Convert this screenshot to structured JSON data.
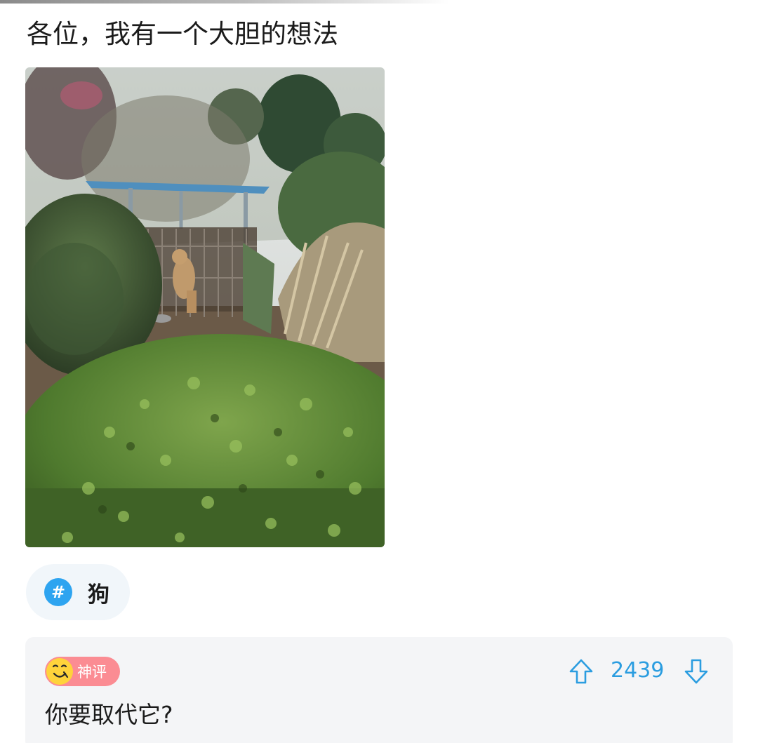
{
  "post": {
    "title": "各位，我有一个大胆的想法"
  },
  "topic": {
    "icon": "hashtag-icon",
    "icon_glyph": "#",
    "label": "狗"
  },
  "comment": {
    "badge_label": "神评",
    "badge_icon": "smiley-face-icon",
    "vote_count": "2439",
    "text": "你要取代它?"
  },
  "colors": {
    "accent_blue": "#2b9de0",
    "badge_pink": "#fb8c93",
    "badge_yellow": "#ffd33b",
    "card_bg": "#f4f5f7",
    "chip_bg": "#f1f6fa"
  }
}
